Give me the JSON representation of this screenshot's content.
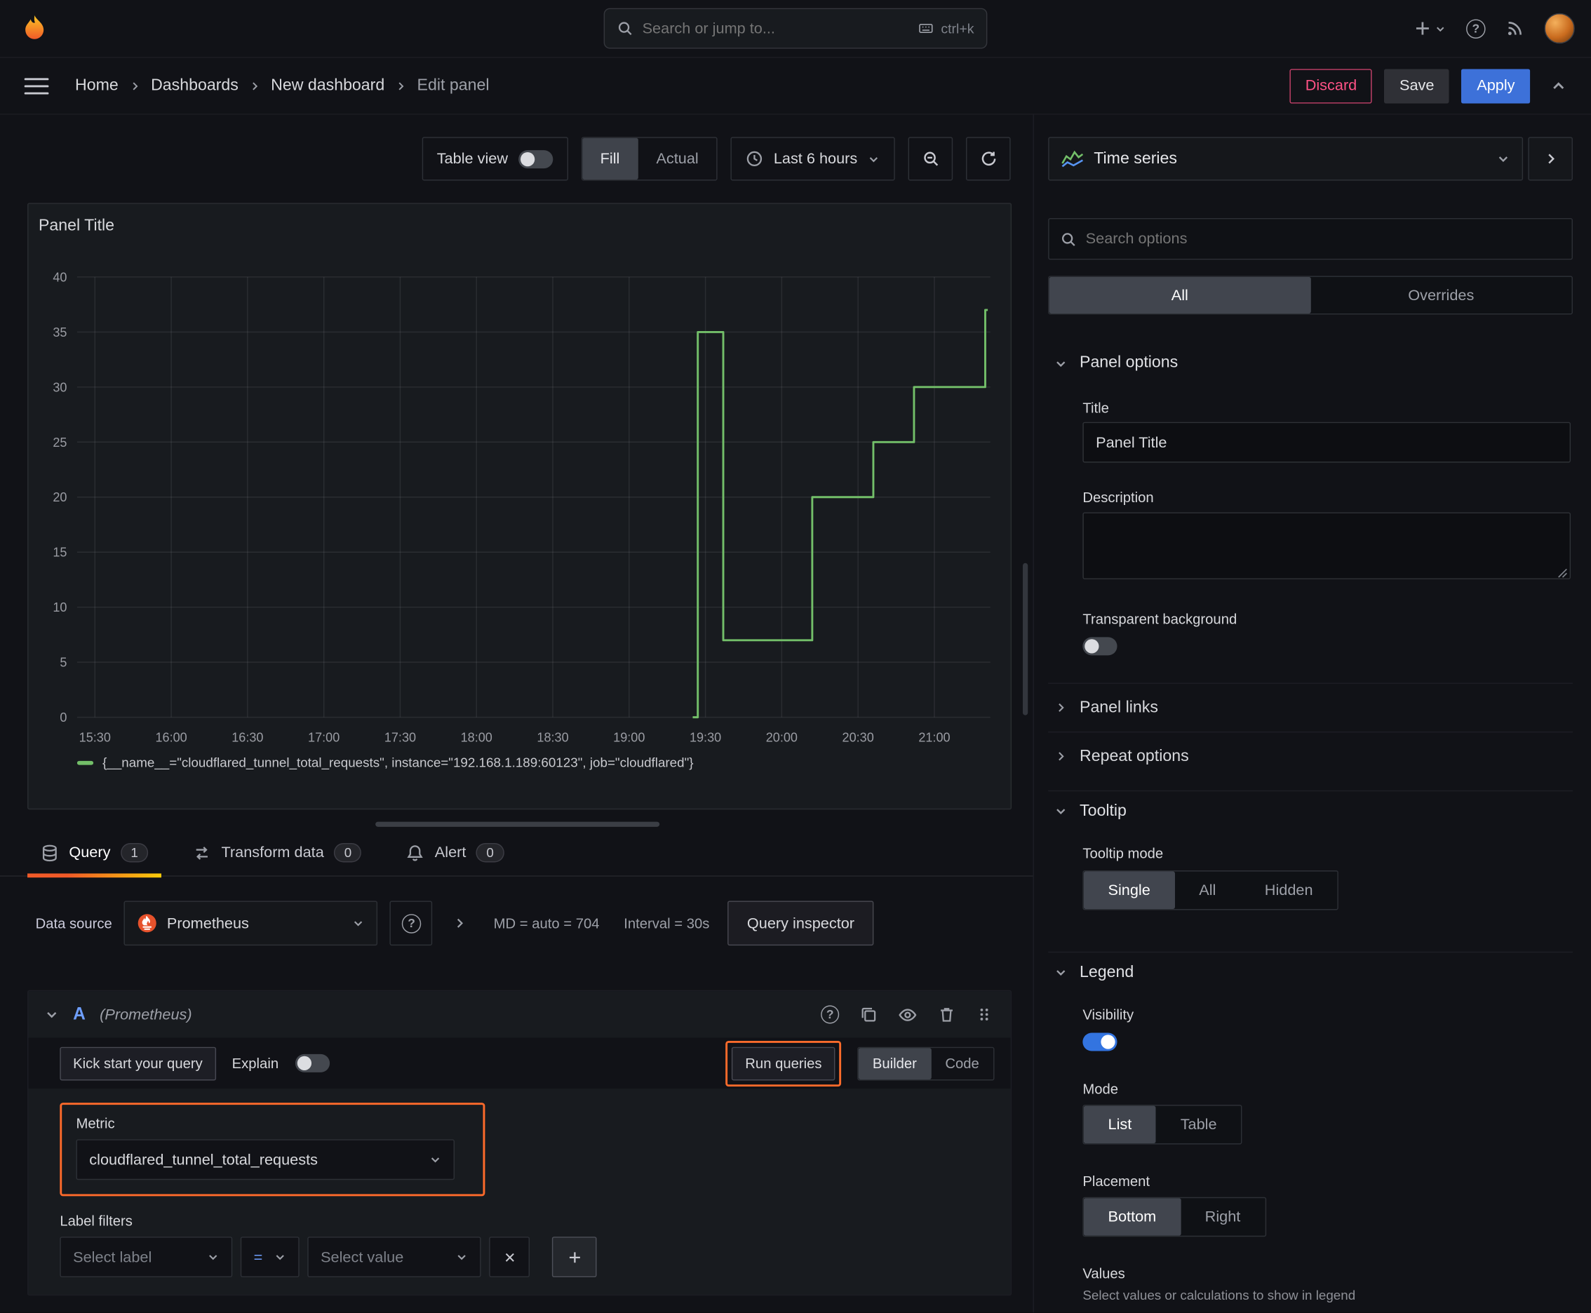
{
  "top_bar": {
    "search_placeholder": "Search or jump to...",
    "shortcut_hint": "ctrl+k"
  },
  "nav": {
    "breadcrumbs": [
      "Home",
      "Dashboards",
      "New dashboard",
      "Edit panel"
    ],
    "discard": "Discard",
    "save": "Save",
    "apply": "Apply"
  },
  "panel_toolbar": {
    "table_view": "Table view",
    "table_view_on": false,
    "fill": "Fill",
    "actual": "Actual",
    "display_selected": "Fill",
    "time_range": "Last 6 hours"
  },
  "panel": {
    "title": "Panel Title"
  },
  "chart_data": {
    "type": "line",
    "title": "Panel Title",
    "xlabel": "",
    "ylabel": "",
    "ylim": [
      0,
      40
    ],
    "y_ticks": [
      0,
      5,
      10,
      15,
      20,
      25,
      30,
      35,
      40
    ],
    "x_ticks": [
      "15:30",
      "16:00",
      "16:30",
      "17:00",
      "17:30",
      "18:00",
      "18:30",
      "19:00",
      "19:30",
      "20:00",
      "20:30",
      "21:00"
    ],
    "x_range_minutes": [
      923,
      1282
    ],
    "grid": true,
    "legend_position": "bottom",
    "series": [
      {
        "name": "{__name__=\"cloudflared_tunnel_total_requests\", instance=\"192.168.1.189:60123\", job=\"cloudflared\"}",
        "color": "#73bf69",
        "step_points": [
          [
            "19:25",
            0
          ],
          [
            "19:27",
            0
          ],
          [
            "19:27",
            35
          ],
          [
            "19:37",
            35
          ],
          [
            "19:37",
            7
          ],
          [
            "20:12",
            7
          ],
          [
            "20:12",
            20
          ],
          [
            "20:36",
            20
          ],
          [
            "20:36",
            25
          ],
          [
            "20:52",
            25
          ],
          [
            "20:52",
            30
          ],
          [
            "21:20",
            30
          ],
          [
            "21:20",
            37
          ],
          [
            "21:21",
            37
          ]
        ]
      }
    ]
  },
  "tabs": {
    "query": {
      "label": "Query",
      "badge": "1"
    },
    "transform": {
      "label": "Transform data",
      "badge": "0"
    },
    "alert": {
      "label": "Alert",
      "badge": "0"
    }
  },
  "datasource_row": {
    "label": "Data source",
    "value": "Prometheus",
    "max_data_points": "MD = auto = 704",
    "interval": "Interval = 30s",
    "query_inspector": "Query inspector"
  },
  "query_editor": {
    "ref_id": "A",
    "ref_hint": "(Prometheus)",
    "kick_start": "Kick start your query",
    "explain": "Explain",
    "explain_on": false,
    "run_queries": "Run queries",
    "builder": "Builder",
    "code": "Code",
    "editor_mode_selected": "Builder",
    "metric_label": "Metric",
    "metric_value": "cloudflared_tunnel_total_requests",
    "label_filters": "Label filters",
    "select_label": "Select label",
    "operator": "=",
    "select_value": "Select value"
  },
  "options_pane": {
    "viz_name": "Time series",
    "search_placeholder": "Search options",
    "filter_all": "All",
    "filter_overrides": "Overrides",
    "filter_selected": "All",
    "panel_options": {
      "header": "Panel options",
      "title_label": "Title",
      "title_value": "Panel Title",
      "description_label": "Description",
      "description_value": "",
      "transparent_label": "Transparent background",
      "transparent_on": false,
      "panel_links": "Panel links",
      "repeat_options": "Repeat options"
    },
    "tooltip": {
      "header": "Tooltip",
      "mode_label": "Tooltip mode",
      "modes": [
        "Single",
        "All",
        "Hidden"
      ],
      "selected": "Single"
    },
    "legend": {
      "header": "Legend",
      "visibility_label": "Visibility",
      "visibility_on": true,
      "mode_label": "Mode",
      "modes": [
        "List",
        "Table"
      ],
      "selected_mode": "List",
      "placement_label": "Placement",
      "placements": [
        "Bottom",
        "Right"
      ],
      "selected_placement": "Bottom",
      "values_label": "Values",
      "values_hint": "Select values or calculations to show in legend"
    }
  }
}
